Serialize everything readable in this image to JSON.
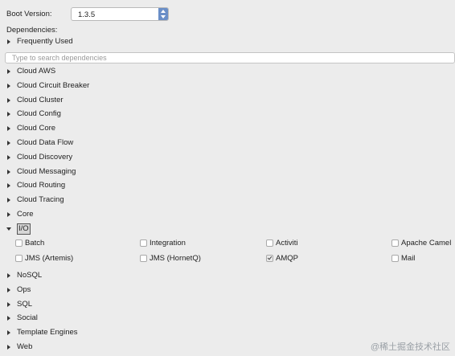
{
  "boot_version": {
    "label": "Boot Version:",
    "value": "1.3.5"
  },
  "dependencies_label": "Dependencies:",
  "frequently_used": "Frequently Used",
  "search": {
    "placeholder": "Type to search dependencies"
  },
  "categories_top": [
    "Cloud AWS",
    "Cloud Circuit Breaker",
    "Cloud Cluster",
    "Cloud Config",
    "Cloud Core",
    "Cloud Data Flow",
    "Cloud Discovery",
    "Cloud Messaging",
    "Cloud Routing",
    "Cloud Tracing",
    "Core"
  ],
  "expanded_category": "I/O",
  "io_items": [
    {
      "label": "Batch",
      "checked": false
    },
    {
      "label": "Integration",
      "checked": false
    },
    {
      "label": "Activiti",
      "checked": false
    },
    {
      "label": "Apache Camel",
      "checked": false
    },
    {
      "label": "JMS (Artemis)",
      "checked": false
    },
    {
      "label": "JMS (HornetQ)",
      "checked": false
    },
    {
      "label": "AMQP",
      "checked": true
    },
    {
      "label": "Mail",
      "checked": false
    }
  ],
  "categories_bottom": [
    "NoSQL",
    "Ops",
    "SQL",
    "Social",
    "Template Engines",
    "Web"
  ],
  "watermark": "@稀土掘金技术社区"
}
